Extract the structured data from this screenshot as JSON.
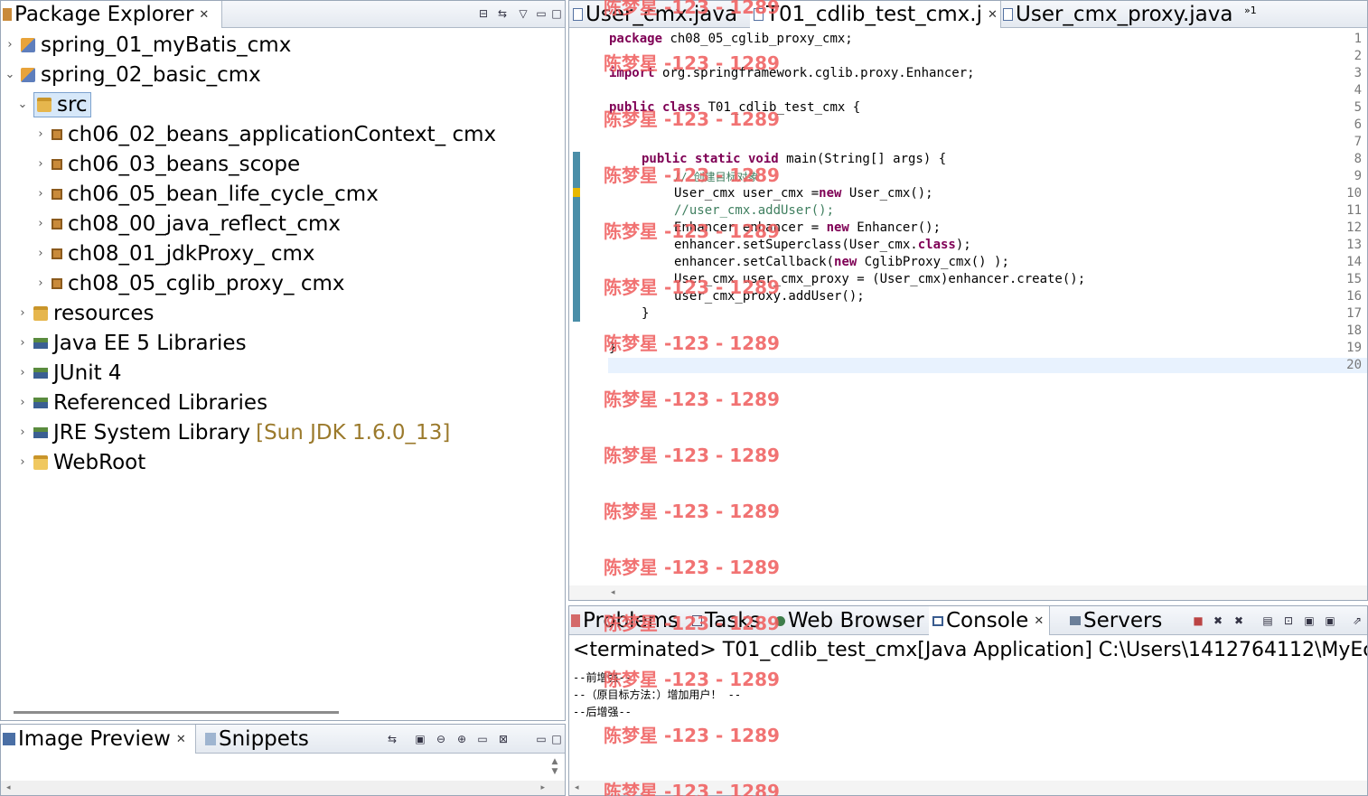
{
  "package_explorer": {
    "title": "Package Explorer",
    "projects": [
      {
        "name": "spring_01_myBatis_cmx",
        "expanded": false
      },
      {
        "name": "spring_02_basic_cmx",
        "expanded": true
      }
    ],
    "src": "src",
    "packages": [
      "ch06_02_beans_applicationContext_ cmx",
      "ch06_03_beans_scope",
      "ch06_05_bean_life_cycle_cmx",
      "ch08_00_java_reflect_cmx",
      "ch08_01_jdkProxy_ cmx",
      "ch08_05_cglib_proxy_ cmx"
    ],
    "other_nodes": [
      {
        "label": "resources",
        "icon": "folder-icon"
      },
      {
        "label": "Java EE 5 Libraries",
        "icon": "library-icon"
      },
      {
        "label": "JUnit 4",
        "icon": "library-icon"
      },
      {
        "label": "Referenced Libraries",
        "icon": "library-icon"
      },
      {
        "label": "JRE System Library",
        "icon": "library-icon",
        "decor": "[Sun JDK 1.6.0_13]"
      },
      {
        "label": "WebRoot",
        "icon": "folder-icon"
      }
    ]
  },
  "bottom_left": {
    "tab1": "Image Preview",
    "tab2": "Snippets"
  },
  "editor": {
    "tabs": [
      "User_cmx.java",
      "T01_cdlib_test_cmx.j",
      "User_cmx_proxy.java"
    ],
    "overflow": "»1",
    "line_numbers": [
      "1",
      "2",
      "3",
      "4",
      "5",
      "6",
      "7",
      "8",
      "9",
      "10",
      "11",
      "12",
      "13",
      "14",
      "15",
      "16",
      "17",
      "18",
      "19",
      "20"
    ],
    "lines": {
      "l1": {
        "kw": "package",
        "rest": " ch08_05_cglib_proxy_cmx;"
      },
      "l3": {
        "kw": "import",
        "rest": " org.springframework.cglib.proxy.Enhancer;"
      },
      "l5": {
        "kw": "public class",
        "rest": " T01_cdlib_test_cmx {"
      },
      "l8": {
        "kw": "public static void",
        "rest": " main(String[] args) {"
      },
      "l9": "// 创建目标对象",
      "l10": {
        "a": "User_cmx user_cmx =",
        "kw": "new",
        "b": " User_cmx();"
      },
      "l11": "//user_cmx.addUser();",
      "l12": {
        "a": "Enhancer enhancer = ",
        "kw": "new",
        "b": " Enhancer();"
      },
      "l13": {
        "a": "enhancer.setSuperclass(User_cmx.",
        "kw": "class",
        "b": ");"
      },
      "l14": {
        "a": "enhancer.setCallback(",
        "kw": "new",
        "b": " CglibProxy_cmx() );"
      },
      "l15": "User_cmx user_cmx_proxy = (User_cmx)enhancer.create();",
      "l16": "user_cmx_proxy.addUser();",
      "l17": "}",
      "l19": "}"
    }
  },
  "bottom_right": {
    "tabs": [
      "Problems",
      "Tasks",
      "Web Browser",
      "Console",
      "Servers"
    ],
    "status": "<terminated> T01_cdlib_test_cmx[Java Application] C:\\Users\\1412764112\\MyEcl",
    "output": [
      "--前增强--",
      "--（原目标方法：）增加用户！ --",
      "--后增强--"
    ]
  },
  "watermark": "陈梦星 -123 - 1289"
}
